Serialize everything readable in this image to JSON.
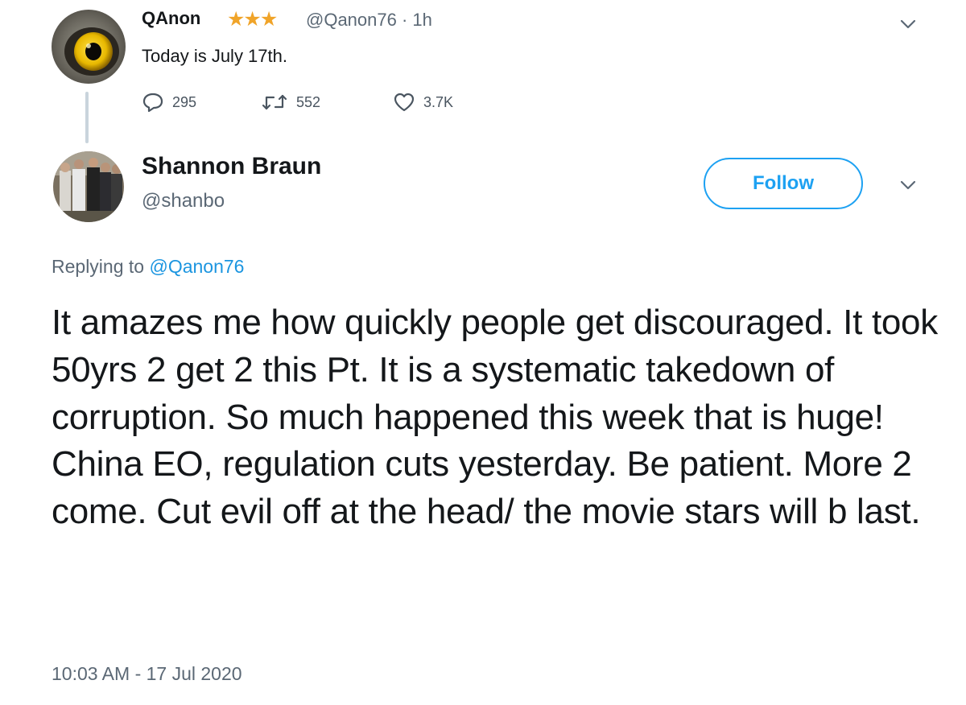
{
  "parent_tweet": {
    "name": "QAnon",
    "stars": "★★★",
    "handle": "@Qanon76",
    "time": "1h",
    "text": "Today is July 17th.",
    "replies": "295",
    "retweets": "552",
    "likes": "3.7K"
  },
  "reply_tweet": {
    "name": "Shannon Braun",
    "handle": "@shanbo",
    "follow_label": "Follow",
    "replying_prefix": "Replying to",
    "replying_handle": "@Qanon76",
    "text": "It amazes me how quickly people get discouraged. It took 50yrs 2 get 2 this Pt. It is a systematic takedown of corruption. So much happened this week that is huge! China EO, regulation cuts yesterday. Be patient. More 2 come. Cut evil off at the head/ the movie stars will b last.",
    "timestamp": "10:03 AM - 17 Jul 2020"
  },
  "colors": {
    "accent": "#1da1f2",
    "link": "#1b95e0",
    "muted": "#5b6875",
    "text": "#14171a",
    "star": "#f0a429"
  },
  "icons": {
    "reply": "reply-icon",
    "retweet": "retweet-icon",
    "like": "heart-icon",
    "menu": "chevron-down-icon"
  }
}
